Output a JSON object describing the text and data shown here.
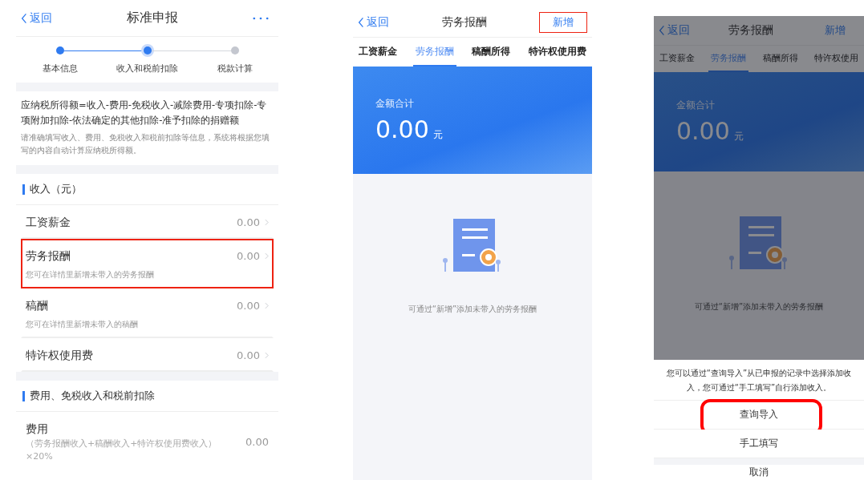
{
  "declaration": {
    "back": "返回",
    "title": "标准申报",
    "steps": [
      {
        "label": "基本信息",
        "reached": true,
        "selected": false
      },
      {
        "label": "收入和税前扣除",
        "reached": true,
        "selected": true
      },
      {
        "label": "税款计算",
        "reached": false,
        "selected": false
      }
    ],
    "formula": "应纳税所得额=收入-费用-免税收入-减除费用-专项扣除-专项附加扣除-依法确定的其他扣除-准予扣除的捐赠额",
    "hint": "请准确填写收入、费用、免税收入和税前扣除等信息，系统将根据您填写的内容自动计算应纳税所得额。",
    "sections": [
      {
        "title": "收入（元）",
        "rows": [
          {
            "label": "工资薪金",
            "value": "0.00",
            "highlighted": false
          },
          {
            "label": "劳务报酬",
            "value": "0.00",
            "note": "您可在详情里新增未带入的劳务报酬",
            "highlighted": true
          },
          {
            "label": "稿酬",
            "value": "0.00",
            "note": "您可在详情里新增未带入的稿酬",
            "highlighted": false
          },
          {
            "label": "特许权使用费",
            "value": "0.00",
            "highlighted": false
          }
        ]
      },
      {
        "title": "费用、免税收入和税前扣除",
        "rows": [
          {
            "label": "费用",
            "value": "0.00",
            "note": "（劳务报酬收入+稿酬收入+特许权使用费收入）×20%",
            "highlighted": false,
            "kind": "formula"
          }
        ]
      }
    ]
  },
  "details": [
    {
      "back": "返回",
      "title": "劳务报酬",
      "action": {
        "label": "新增",
        "highlighted": true
      },
      "dimmed": false,
      "tabs": [
        {
          "label": "工资薪金",
          "selected": false
        },
        {
          "label": "劳务报酬",
          "selected": true
        },
        {
          "label": "稿酬所得",
          "selected": false
        },
        {
          "label": "特许权使用费",
          "selected": false
        }
      ],
      "total_label": "金额合计",
      "total": "0.00",
      "unit": "元",
      "empty_text": "可通过“新增”添加未带入的劳务报酬"
    },
    {
      "back": "返回",
      "title": "劳务报酬",
      "action": {
        "label": "新增",
        "highlighted": false
      },
      "dimmed": true,
      "tabs": [
        {
          "label": "工资薪金",
          "selected": false
        },
        {
          "label": "劳务报酬",
          "selected": true
        },
        {
          "label": "稿酬所得",
          "selected": false
        },
        {
          "label": "特许权使用",
          "selected": false
        }
      ],
      "total_label": "金额合计",
      "total": "0.00",
      "unit": "元",
      "empty_text": "可通过“新增”添加未带入的劳务报酬",
      "sheet": {
        "message": "您可以通过“查询导入”从已申报的记录中选择添加收入，您可通过“手工填写”自行添加收入。",
        "options": [
          {
            "label": "查询导入",
            "highlighted": true
          },
          {
            "label": "手工填写",
            "highlighted": false
          }
        ],
        "cancel": "取消"
      }
    }
  ]
}
